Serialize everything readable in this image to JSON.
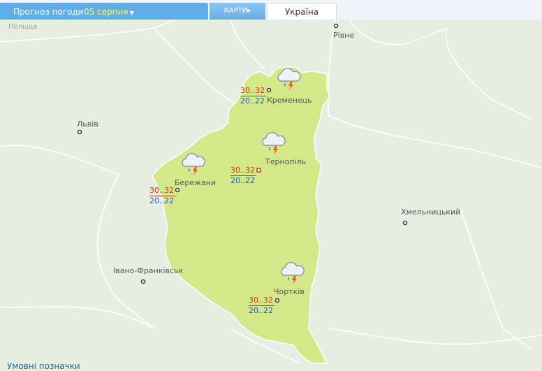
{
  "header": {
    "title": "Прогноз погоди",
    "date": "05 серпня",
    "maps_button": "КАРТИ",
    "region_tab": "Україна"
  },
  "cities": {
    "poland": "Польща",
    "rivne": "Рівне",
    "lviv": "Львів",
    "ivano": "Івано-Франківськ",
    "khmelnytskyi": "Хмельницький",
    "kremenets": "Кременець",
    "ternopil": "Тернопіль",
    "berezhany": "Бережани",
    "chortkiv": "Чортків"
  },
  "forecasts": {
    "kremenets": {
      "day": "30..32",
      "night": "20..22",
      "icon": "cloud-rain-thunder-icon"
    },
    "ternopil": {
      "day": "30..32",
      "night": "20..22",
      "icon": "cloud-rain-thunder-icon"
    },
    "berezhany": {
      "day": "30..32",
      "night": "20..22",
      "icon": "cloud-rain-thunder-icon"
    },
    "chortkiv": {
      "day": "30..32",
      "night": "20..22",
      "icon": "cloud-rain-thunder-icon"
    }
  },
  "footer": {
    "legend_link": "Умовні позначки"
  },
  "colors": {
    "region_fill": "#d4e88a",
    "background": "#e6ede1",
    "header_blue": "#5faee9",
    "date_yellow": "#fff566",
    "day_temp": "#c83c1a",
    "night_temp": "#1f5fbf"
  }
}
